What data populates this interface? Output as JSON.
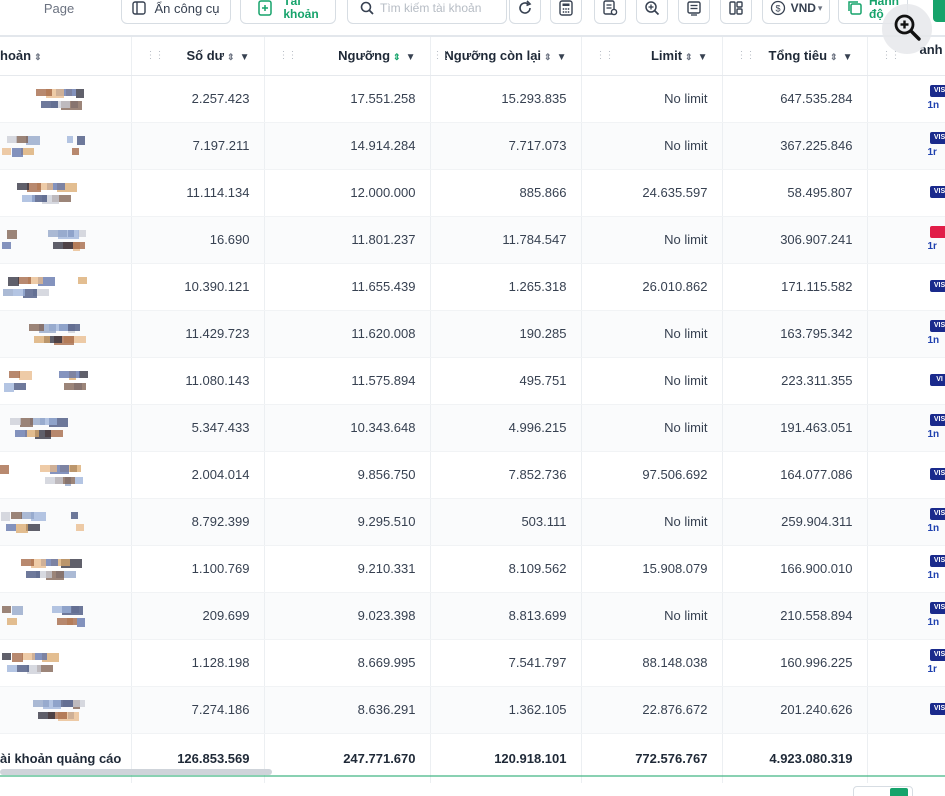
{
  "toolbar": {
    "page_label": "Page",
    "hide_tools_label": "Ẩn công cụ",
    "account_label_line1": "Tài",
    "account_label_line2": "khoản",
    "search_placeholder": "Tìm kiếm tài khoản",
    "currency_label": "VND",
    "actions_label_line1": "Hành",
    "actions_label_line2": "độ"
  },
  "colors": {
    "accent": "#16a36b",
    "badge_blue": "#1a2a8c",
    "badge_red": "#e11d48"
  },
  "table": {
    "headers": {
      "account": "hoản",
      "balance": "Số dư",
      "threshold": "Ngưỡng",
      "remaining": "Ngưỡng còn lại",
      "limit": "Limit",
      "total_spend": "Tổng tiêu",
      "payment": "anh"
    },
    "rows": [
      {
        "balance": "2.257.423",
        "threshold": "17.551.258",
        "remaining": "15.293.835",
        "limit": "No limit",
        "total": "647.535.284",
        "badge": "VIS",
        "sub": "1n"
      },
      {
        "balance": "7.197.211",
        "threshold": "14.914.284",
        "remaining": "7.717.073",
        "limit": "No limit",
        "total": "367.225.846",
        "badge": "VIS",
        "sub": "1r"
      },
      {
        "balance": "11.114.134",
        "threshold": "12.000.000",
        "remaining": "885.866",
        "limit": "24.635.597",
        "total": "58.495.807",
        "badge": "VIS",
        "sub": ""
      },
      {
        "balance": "16.690",
        "threshold": "11.801.237",
        "remaining": "11.784.547",
        "limit": "No limit",
        "total": "306.907.241",
        "badge": "",
        "sub": "1r"
      },
      {
        "balance": "10.390.121",
        "threshold": "11.655.439",
        "remaining": "1.265.318",
        "limit": "26.010.862",
        "total": "171.115.582",
        "badge": "VIS",
        "sub": ""
      },
      {
        "balance": "11.429.723",
        "threshold": "11.620.008",
        "remaining": "190.285",
        "limit": "No limit",
        "total": "163.795.342",
        "badge": "VIS",
        "sub": "1n"
      },
      {
        "balance": "11.080.143",
        "threshold": "11.575.894",
        "remaining": "495.751",
        "limit": "No limit",
        "total": "223.311.355",
        "badge": "VI",
        "sub": ""
      },
      {
        "balance": "5.347.433",
        "threshold": "10.343.648",
        "remaining": "4.996.215",
        "limit": "No limit",
        "total": "191.463.051",
        "badge": "VIS",
        "sub": "1n"
      },
      {
        "balance": "2.004.014",
        "threshold": "9.856.750",
        "remaining": "7.852.736",
        "limit": "97.506.692",
        "total": "164.077.086",
        "badge": "VIS",
        "sub": ""
      },
      {
        "balance": "8.792.399",
        "threshold": "9.295.510",
        "remaining": "503.111",
        "limit": "No limit",
        "total": "259.904.311",
        "badge": "VIS",
        "sub": "1n"
      },
      {
        "balance": "1.100.769",
        "threshold": "9.210.331",
        "remaining": "8.109.562",
        "limit": "15.908.079",
        "total": "166.900.010",
        "badge": "VIS",
        "sub": "1n"
      },
      {
        "balance": "209.699",
        "threshold": "9.023.398",
        "remaining": "8.813.699",
        "limit": "No limit",
        "total": "210.558.894",
        "badge": "VIS",
        "sub": "1n"
      },
      {
        "balance": "1.128.198",
        "threshold": "8.669.995",
        "remaining": "7.541.797",
        "limit": "88.148.038",
        "total": "160.996.225",
        "badge": "VIS",
        "sub": "1r"
      },
      {
        "balance": "7.274.186",
        "threshold": "8.636.291",
        "remaining": "1.362.105",
        "limit": "22.876.672",
        "total": "201.240.626",
        "badge": "VIS",
        "sub": ""
      }
    ],
    "footer": {
      "label": "ài khoản quảng cáo",
      "balance": "126.853.569",
      "threshold": "247.771.670",
      "remaining": "120.918.101",
      "limit": "772.576.767",
      "total": "4.923.080.319"
    }
  }
}
